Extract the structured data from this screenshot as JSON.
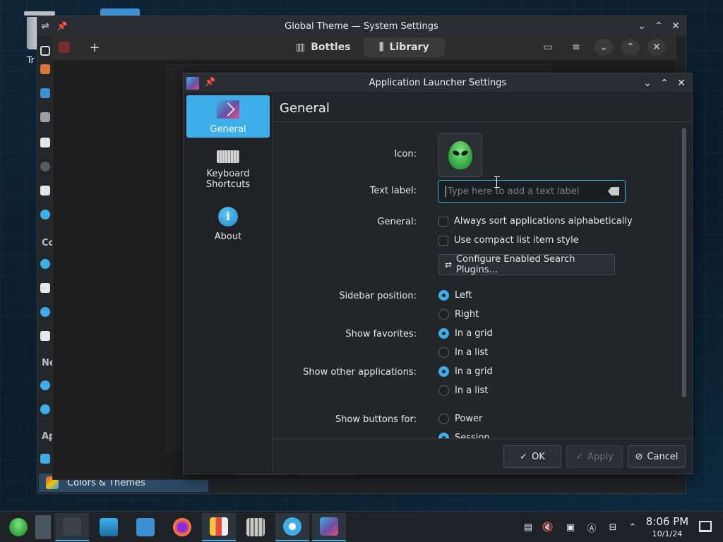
{
  "desktop": {
    "trash_label": "Tr"
  },
  "system_settings": {
    "title": "Global Theme — System Settings",
    "sections": [
      "Co",
      "Ne",
      "Ap"
    ],
    "selected_item": "Colors & Themes"
  },
  "bottles": {
    "tabs": [
      {
        "label": "Bottles"
      },
      {
        "label": "Library"
      }
    ]
  },
  "dialog": {
    "title": "Application Launcher Settings",
    "categories": [
      {
        "label": "General",
        "icon": "launcher-icon"
      },
      {
        "label": "Keyboard Shortcuts",
        "icon": "keyboard-icon"
      },
      {
        "label": "About",
        "icon": "info-icon"
      }
    ],
    "page_title": "General",
    "form": {
      "icon_label": "Icon:",
      "text_label": "Text label:",
      "text_placeholder": "Type here to add a text label",
      "general_label": "General:",
      "sort_alpha": "Always sort applications alphabetically",
      "compact_list": "Use compact list item style",
      "configure_plugins": "Configure Enabled Search Plugins...",
      "sidebar_position_label": "Sidebar position:",
      "sidebar_left": "Left",
      "sidebar_right": "Right",
      "show_favorites_label": "Show favorites:",
      "fav_grid": "In a grid",
      "fav_list": "In a list",
      "show_other_label": "Show other applications:",
      "other_grid": "In a grid",
      "other_list": "In a list",
      "show_buttons_label": "Show buttons for:",
      "btn_power": "Power",
      "btn_session": "Session"
    },
    "footer": {
      "ok": "OK",
      "apply": "Apply",
      "cancel": "Cancel"
    }
  },
  "taskbar": {
    "clock_time": "8:06 PM",
    "clock_date": "10/1/24"
  },
  "colors": {
    "accent": "#3daee9",
    "window_bg": "#232629"
  }
}
